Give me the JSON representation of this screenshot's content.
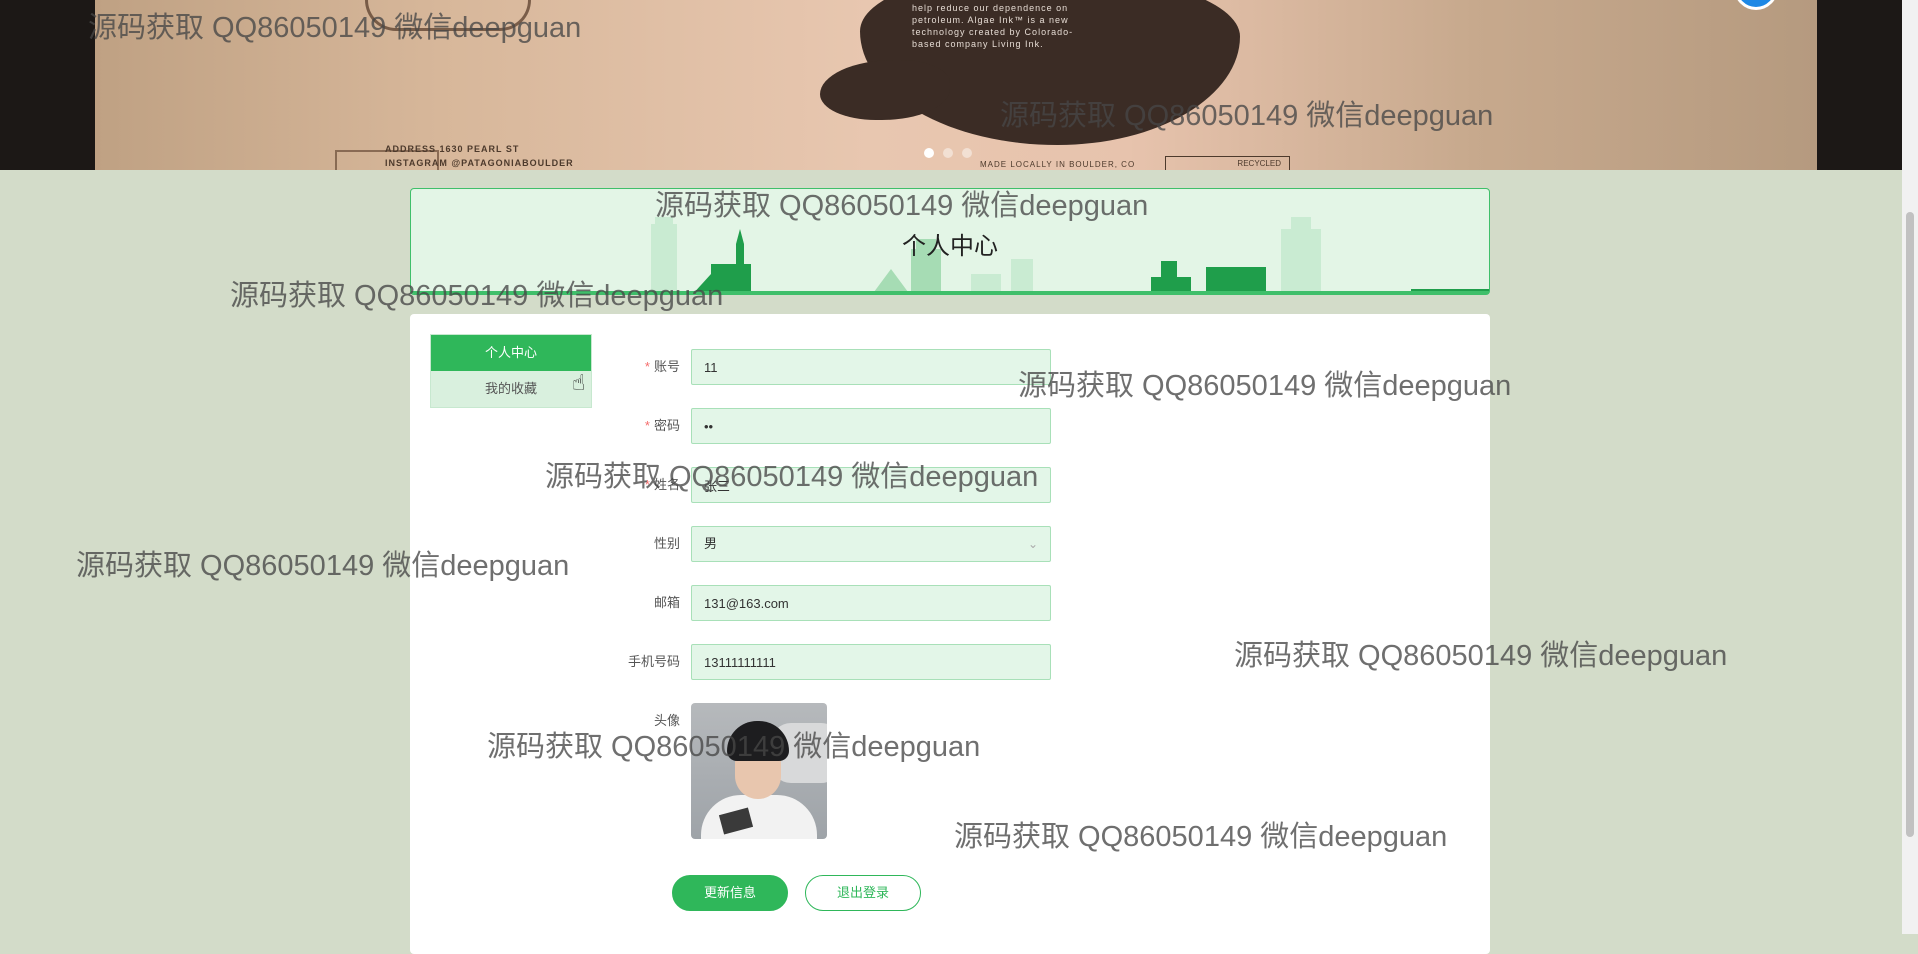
{
  "banner": {
    "address_lines": [
      "ADDRESS      1630 PEARL ST",
      "INSTAGRAM   @PATAGONIABOULDER"
    ],
    "blob_text_lines": [
      "help reduce our dependence on",
      "petroleum. Algae Ink™ is a new",
      "technology created by Colorado-",
      "based company Living Ink."
    ],
    "made_text": "MADE LOCALLY IN BOULDER, CO",
    "recycled_text": "RECYCLED",
    "carousel_active_index": 0
  },
  "header": {
    "title": "个人中心"
  },
  "side_menu": {
    "items": [
      {
        "label": "个人中心",
        "active": true
      },
      {
        "label": "我的收藏",
        "active": false
      }
    ]
  },
  "form": {
    "account_label": "账号",
    "account_value": "11",
    "password_label": "密码",
    "password_value": "11",
    "name_label": "姓名",
    "name_value": "张三",
    "gender_label": "性别",
    "gender_value": "男",
    "email_label": "邮箱",
    "email_value": "131@163.com",
    "phone_label": "手机号码",
    "phone_value": "13111111111",
    "avatar_label": "头像",
    "required_mark": "*"
  },
  "actions": {
    "update_label": "更新信息",
    "logout_label": "退出登录"
  },
  "watermark_text": "源码获取 QQ86050149 微信deepguan",
  "colors": {
    "accent": "#2fb75a",
    "input_bg": "#e3f6e8",
    "page_bg": "#d3dcc9",
    "required": "#f56c6c"
  }
}
